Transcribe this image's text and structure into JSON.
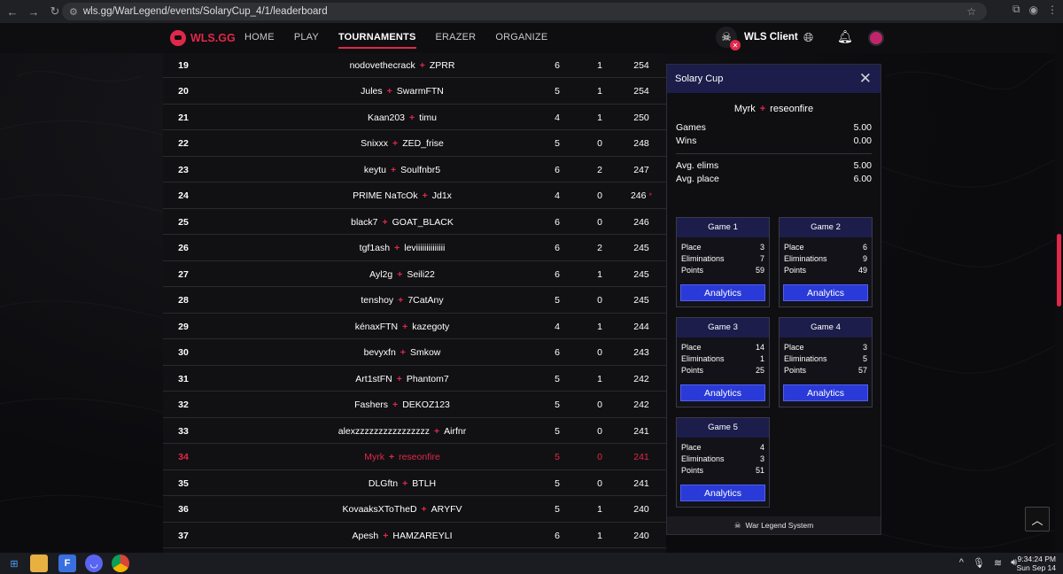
{
  "browser": {
    "url": "wls.gg/WarLegend/events/SolaryCup_4/1/leaderboard"
  },
  "header": {
    "logo": "WLS.GG",
    "nav": [
      "HOME",
      "PLAY",
      "TOURNAMENTS",
      "ERAZER",
      "ORGANIZE"
    ],
    "active_nav": "TOURNAMENTS",
    "client_label": "WLS Client"
  },
  "leaderboard": {
    "rows": [
      {
        "rank": "19",
        "p1": "nodovethecrack",
        "p2": "ZPRR",
        "games": "6",
        "wins": "1",
        "points": "254"
      },
      {
        "rank": "20",
        "p1": "Jules",
        "p2": "SwarmFTN",
        "games": "5",
        "wins": "1",
        "points": "254"
      },
      {
        "rank": "21",
        "p1": "Kaan203",
        "p2": "timu",
        "games": "4",
        "wins": "1",
        "points": "250"
      },
      {
        "rank": "22",
        "p1": "Snixxx",
        "p2": "ZED_frise",
        "games": "5",
        "wins": "0",
        "points": "248"
      },
      {
        "rank": "23",
        "p1": "keytu",
        "p2": "Soulfnbr5",
        "games": "6",
        "wins": "2",
        "points": "247"
      },
      {
        "rank": "24",
        "p1": "PRIME NaTcOk",
        "p2": "Jd1x",
        "games": "4",
        "wins": "0",
        "points": "246",
        "mark": "*"
      },
      {
        "rank": "25",
        "p1": "black7",
        "p2": "GOAT_BLACK",
        "games": "6",
        "wins": "0",
        "points": "246"
      },
      {
        "rank": "26",
        "p1": "tgf1ash",
        "p2": "leviiiiiiiiiiiiii",
        "games": "6",
        "wins": "2",
        "points": "245"
      },
      {
        "rank": "27",
        "p1": "Ayl2g",
        "p2": "Seili22",
        "games": "6",
        "wins": "1",
        "points": "245"
      },
      {
        "rank": "28",
        "p1": "tenshoy",
        "p2": "7CatAny",
        "games": "5",
        "wins": "0",
        "points": "245"
      },
      {
        "rank": "29",
        "p1": "kénaxFTN",
        "p2": "kazegoty",
        "games": "4",
        "wins": "1",
        "points": "244"
      },
      {
        "rank": "30",
        "p1": "bevyxfn",
        "p2": "Smkow",
        "games": "6",
        "wins": "0",
        "points": "243"
      },
      {
        "rank": "31",
        "p1": "Art1stFN",
        "p2": "Phantom7",
        "games": "5",
        "wins": "1",
        "points": "242"
      },
      {
        "rank": "32",
        "p1": "Fashers",
        "p2": "DEKOZ123",
        "games": "5",
        "wins": "0",
        "points": "242"
      },
      {
        "rank": "33",
        "p1": "alexzzzzzzzzzzzzzzzz",
        "p2": "Airfnr",
        "games": "5",
        "wins": "0",
        "points": "241"
      },
      {
        "rank": "34",
        "p1": "Myrk",
        "p2": "reseonfire",
        "games": "5",
        "wins": "0",
        "points": "241",
        "highlight": true
      },
      {
        "rank": "35",
        "p1": "DLGftn",
        "p2": "BTLH",
        "games": "5",
        "wins": "0",
        "points": "241"
      },
      {
        "rank": "36",
        "p1": "KovaaksXToTheD",
        "p2": "ARYFV",
        "games": "5",
        "wins": "1",
        "points": "240"
      },
      {
        "rank": "37",
        "p1": "Apesh",
        "p2": "HAMZAREYLI",
        "games": "6",
        "wins": "1",
        "points": "240"
      }
    ]
  },
  "panel": {
    "title": "Solary Cup",
    "team_p1": "Myrk",
    "team_p2": "reseonfire",
    "stats_top": [
      {
        "label": "Games",
        "value": "5.00"
      },
      {
        "label": "Wins",
        "value": "0.00"
      }
    ],
    "stats_bottom": [
      {
        "label": "Avg. elims",
        "value": "5.00"
      },
      {
        "label": "Avg. place",
        "value": "6.00"
      }
    ],
    "place_label": "Place",
    "elims_label": "Eliminations",
    "points_label": "Points",
    "button_label": "Analytics",
    "games": [
      {
        "title": "Game 1",
        "place": "3",
        "elims": "7",
        "points": "59"
      },
      {
        "title": "Game 2",
        "place": "6",
        "elims": "9",
        "points": "49"
      },
      {
        "title": "Game 3",
        "place": "14",
        "elims": "1",
        "points": "25"
      },
      {
        "title": "Game 4",
        "place": "3",
        "elims": "5",
        "points": "57"
      },
      {
        "title": "Game 5",
        "place": "4",
        "elims": "3",
        "points": "51"
      }
    ],
    "footer": "War Legend System"
  },
  "taskbar": {
    "time": "9:34:24 PM",
    "date": "Sun Sep 14"
  },
  "colors": {
    "accent": "#e0284a",
    "button": "#2a3ad8",
    "panel_header": "#1c1d4a"
  }
}
